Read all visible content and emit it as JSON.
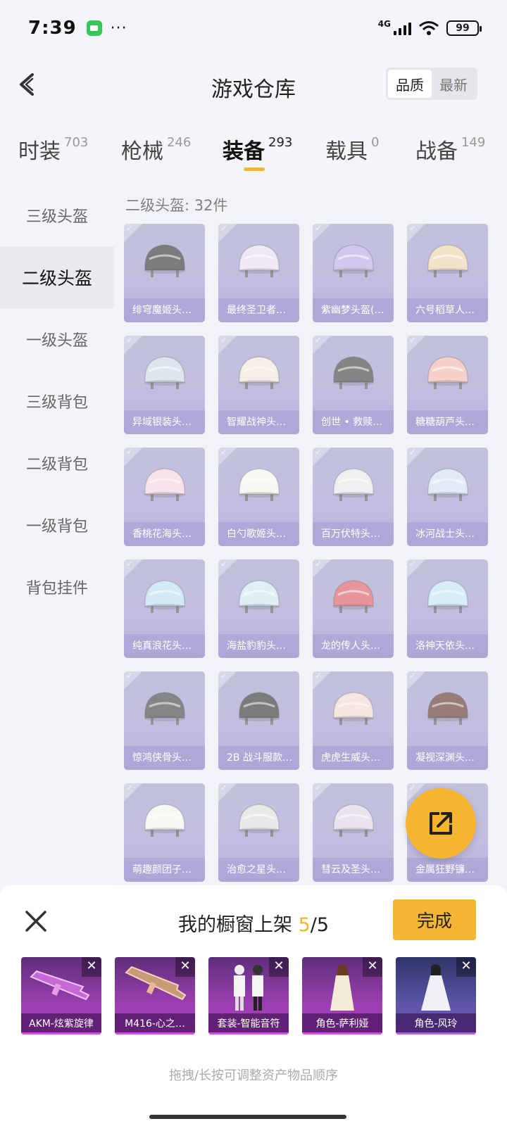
{
  "status_bar": {
    "time": "7:39",
    "dots": "···",
    "network": "4G",
    "battery": "99"
  },
  "header": {
    "title": "游戏仓库",
    "sort_options": [
      "品质",
      "最新"
    ]
  },
  "tabs": [
    {
      "label": "时装",
      "count": "703"
    },
    {
      "label": "枪械",
      "count": "246"
    },
    {
      "label": "装备",
      "count": "293"
    },
    {
      "label": "载具",
      "count": "0"
    },
    {
      "label": "战备",
      "count": "149"
    }
  ],
  "sidebar": {
    "items": [
      "三级头盔",
      "二级头盔",
      "一级头盔",
      "三级背包",
      "二级背包",
      "一级背包",
      "背包挂件"
    ]
  },
  "section_title": "二级头盔: 32件",
  "items": [
    "绯穹魔姬头…",
    "最终圣卫者…",
    "紫幽梦头盔(…",
    "六号稻草人…",
    "异域银装头…",
    "智耀战神头…",
    "创世 • 救赎…",
    "糖糖葫芦头…",
    "香桃花海头…",
    "白勺歌姬头…",
    "百万伏特头…",
    "冰河战士头…",
    "纯真浪花头…",
    "海盐豹豹头…",
    "龙的传人头…",
    "洛神天依头…",
    "惊鸿侠骨头…",
    "2B 战斗服款…",
    "虎虎生威头…",
    "凝视深渊头…",
    "萌趣颜团子…",
    "治愈之星头…",
    "彗云及圣头…",
    "金属狂野镰…"
  ],
  "item_colors": [
    "#2d2a30",
    "#e6dcef",
    "#b7a6e4",
    "#e8d2a8",
    "#c9d7e2",
    "#ede4d4",
    "#3a3a3c",
    "#f0b5a8",
    "#f3d2dc",
    "#f4f2ea",
    "#e6e6ea",
    "#cfe0f2",
    "#b9def0",
    "#cde5f0",
    "#d9555c",
    "#bfe3f2",
    "#3c3a3e",
    "#2c2c2e",
    "#f0d8d2",
    "#5a2c22",
    "#f3f3ee",
    "#dcdcde",
    "#ddd4e6",
    "#4a4a4c"
  ],
  "panel": {
    "title_prefix": "我的橱窗上架 ",
    "count_current": "5",
    "count_total": "/5",
    "done_label": "完成",
    "showcase": [
      "AKM-炫紫旋律",
      "M416-心之…",
      "套装-智能音符",
      "角色-萨利娅",
      "角色-风玲"
    ],
    "hint": "拖拽/长按可调整资产物品顺序"
  }
}
